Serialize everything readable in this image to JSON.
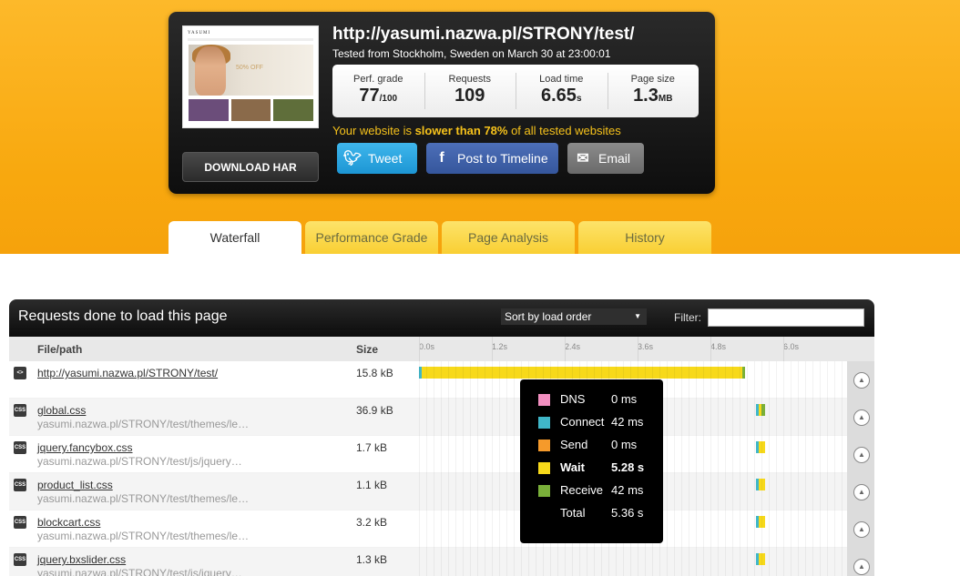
{
  "summary": {
    "url": "http://yasumi.nazwa.pl/STRONY/test/",
    "tested_from": "Tested from Stockholm, Sweden on March 30 at 23:00:01",
    "thumbnail": {
      "logo_text": "YASUMI",
      "offer_text": "50% OFF"
    },
    "stats": [
      {
        "label": "Perf. grade",
        "value": "77",
        "unit": "/100"
      },
      {
        "label": "Requests",
        "value": "109",
        "unit": ""
      },
      {
        "label": "Load time",
        "value": "6.65",
        "unit": "s"
      },
      {
        "label": "Page size",
        "value": "1.3",
        "unit": "MB"
      }
    ],
    "comparison": {
      "prefix": "Your website is ",
      "highlight": "slower than 78%",
      "suffix": " of all tested websites"
    },
    "buttons": {
      "tweet": "Tweet",
      "facebook": "Post to Timeline",
      "email": "Email",
      "download_har": "DOWNLOAD HAR"
    }
  },
  "tabs": [
    {
      "label": "Waterfall",
      "active": true
    },
    {
      "label": "Performance Grade",
      "active": false
    },
    {
      "label": "Page Analysis",
      "active": false
    },
    {
      "label": "History",
      "active": false
    }
  ],
  "panel": {
    "title": "Requests done to load this page",
    "sort_label": "Sort by load order",
    "filter_label": "Filter:",
    "col_file": "File/path",
    "col_size": "Size",
    "timeline_ticks": [
      "0.0s",
      "1.2s",
      "2.4s",
      "3.6s",
      "4.8s",
      "6.0s"
    ],
    "rows": [
      {
        "icon": "<>",
        "name": "http://yasumi.nazwa.pl/STRONY/test/",
        "path": "",
        "size": "15.8 kB",
        "start_s": 0.0,
        "connect_s": 0.042,
        "wait_s": 5.28,
        "receive_s": 0.042
      },
      {
        "icon": "CSS",
        "name": "global.css",
        "path": "yasumi.nazwa.pl/STRONY/test/themes/le…",
        "size": "36.9 kB",
        "start_s": 5.55,
        "connect_s": 0.04,
        "wait_s": 0.05,
        "receive_s": 0.06
      },
      {
        "icon": "CSS",
        "name": "jquery.fancybox.css",
        "path": "yasumi.nazwa.pl/STRONY/test/js/jquery…",
        "size": "1.7 kB",
        "start_s": 5.55,
        "connect_s": 0.04,
        "wait_s": 0.1,
        "receive_s": 0
      },
      {
        "icon": "CSS",
        "name": "product_list.css",
        "path": "yasumi.nazwa.pl/STRONY/test/themes/le…",
        "size": "1.1 kB",
        "start_s": 5.55,
        "connect_s": 0.04,
        "wait_s": 0.1,
        "receive_s": 0
      },
      {
        "icon": "CSS",
        "name": "blockcart.css",
        "path": "yasumi.nazwa.pl/STRONY/test/themes/le…",
        "size": "3.2 kB",
        "start_s": 5.55,
        "connect_s": 0.04,
        "wait_s": 0.1,
        "receive_s": 0
      },
      {
        "icon": "CSS",
        "name": "jquery.bxslider.css",
        "path": "yasumi.nazwa.pl/STRONY/test/js/jquery…",
        "size": "1.3 kB",
        "start_s": 5.55,
        "connect_s": 0.04,
        "wait_s": 0.1,
        "receive_s": 0
      }
    ]
  },
  "tooltip": {
    "rows": [
      {
        "name": "DNS",
        "value": "0 ms",
        "color": "#f28fc0",
        "bold": false
      },
      {
        "name": "Connect",
        "value": "42 ms",
        "color": "#40b7c9",
        "bold": false
      },
      {
        "name": "Send",
        "value": "0 ms",
        "color": "#f59a2b",
        "bold": false
      },
      {
        "name": "Wait",
        "value": "5.28 s",
        "color": "#f7d91a",
        "bold": true
      },
      {
        "name": "Receive",
        "value": "42 ms",
        "color": "#7ab03a",
        "bold": false
      },
      {
        "name": "Total",
        "value": "5.36 s",
        "color": "",
        "bold": false
      }
    ]
  },
  "colors": {
    "accent_yellow": "#f8a80e",
    "wait": "#f7d91a",
    "connect": "#40b7c9",
    "receive": "#7ab03a"
  }
}
